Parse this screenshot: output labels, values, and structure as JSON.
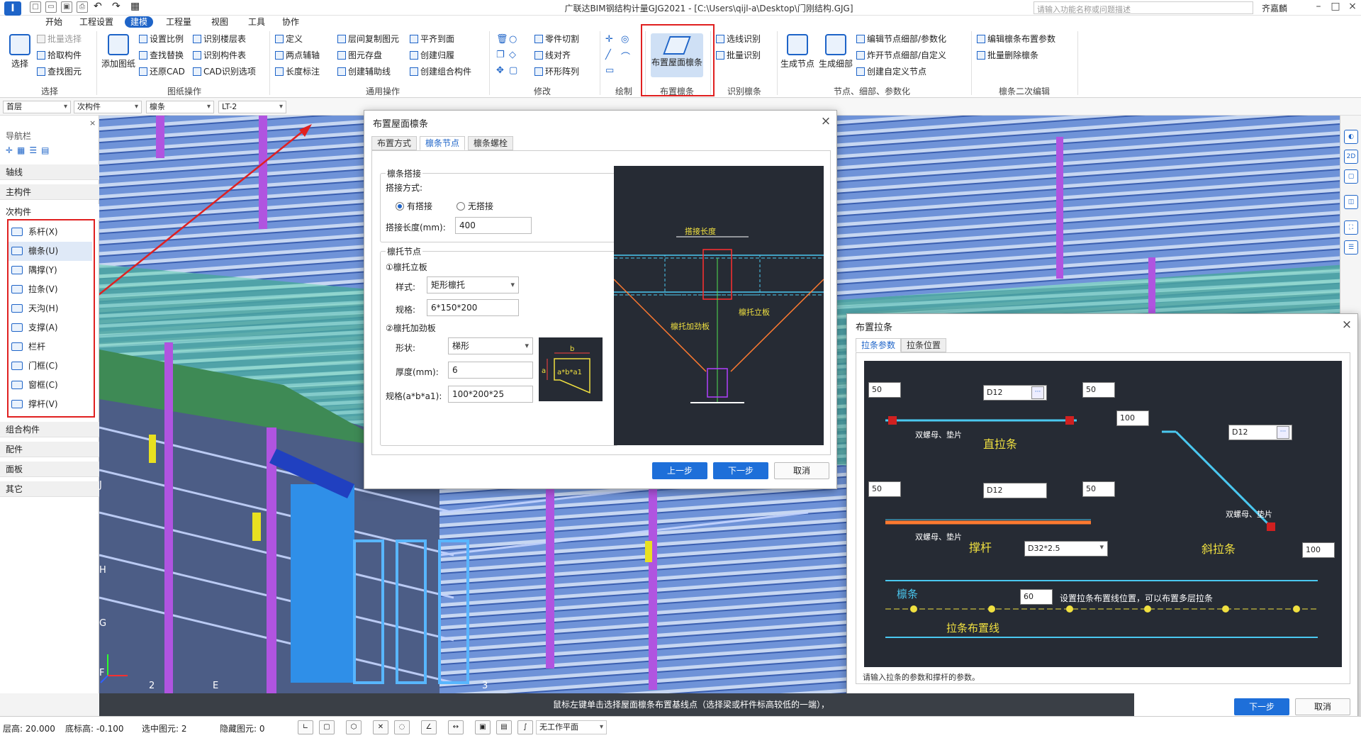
{
  "titlebar": {
    "title": "广联达BIM钢结构计量GJG2021 - [C:\\Users\\qijl-a\\Desktop\\门刚结构.GJG]",
    "search_placeholder": "请输入功能名称或问题描述",
    "user": "齐嘉麟"
  },
  "menu": {
    "tabs": [
      "开始",
      "工程设置",
      "建模",
      "工程量",
      "视图",
      "工具",
      "协作"
    ],
    "active": "建模"
  },
  "ribbon": {
    "select_group": {
      "label": "选择",
      "big": "选择",
      "items": [
        "批量选择",
        "拾取构件",
        "查找图元"
      ]
    },
    "drawing_group": {
      "label": "图纸操作",
      "big": "添加图纸",
      "items": [
        "设置比例",
        "查找替换",
        "还原CAD",
        "识别楼层表",
        "识别构件表",
        "CAD识别选项"
      ]
    },
    "common_group": {
      "label": "通用操作",
      "items": [
        "定义",
        "两点辅轴",
        "长度标注",
        "层间复制图元",
        "图元存盘",
        "创建辅助线",
        "平齐到面",
        "创建归履",
        "创建组合构件"
      ]
    },
    "modify_group": {
      "label": "修改",
      "items": [
        "零件切割",
        "线对齐",
        "环形阵列"
      ]
    },
    "draw_group": {
      "label": "绘制"
    },
    "purlin_group": {
      "label": "布置檩条",
      "big": "布置屋面檩条"
    },
    "identify_group": {
      "label": "识别檩条",
      "items": [
        "选线识别",
        "批量识别"
      ]
    },
    "node_group": {
      "label": "节点、细部、参数化",
      "big1": "生成节点",
      "big2": "生成细部",
      "items": [
        "编辑节点细部/参数化",
        "炸开节点细部/自定义",
        "创建自定义节点"
      ]
    },
    "edit_group": {
      "label": "檩条二次编辑",
      "items": [
        "编辑檩条布置参数",
        "批量删除檩条"
      ]
    }
  },
  "combos": [
    "首层",
    "次构件",
    "檩条",
    "LT-2"
  ],
  "nav": {
    "title": "导航栏",
    "groups_top": [
      "轴线",
      "主构件",
      "次构件"
    ],
    "items": [
      "系杆(X)",
      "檩条(U)",
      "隅撑(Y)",
      "拉条(V)",
      "天沟(H)",
      "支撑(A)",
      "栏杆",
      "门框(C)",
      "窗框(C)",
      "撑杆(V)"
    ],
    "selected": "檩条(U)",
    "groups_bottom": [
      "组合构件",
      "配件",
      "面板",
      "其它"
    ]
  },
  "axis_labels": [
    "J",
    "H",
    "G",
    "F",
    "2",
    "E",
    "3"
  ],
  "dialog1": {
    "title": "布置屋面檩条",
    "tabs": [
      "布置方式",
      "檩条节点",
      "檩条螺栓"
    ],
    "active_tab": "檩条节点",
    "lap": {
      "legend": "檩条搭接",
      "mode_label": "搭接方式:",
      "opt1": "有搭接",
      "opt2": "无搭接",
      "length_label": "搭接长度(mm):",
      "length": "400"
    },
    "bracket": {
      "legend": "檩托节点",
      "sub1": "①檩托立板",
      "style_label": "样式:",
      "style": "矩形檩托",
      "spec_label": "规格:",
      "spec": "6*150*200",
      "sub2": "②檩托加劲板",
      "shape_label": "形状:",
      "shape": "梯形",
      "thick_label": "厚度(mm):",
      "thick": "6",
      "spec2_label": "规格(a*b*a1):",
      "spec2": "100*200*25"
    },
    "mini_labels": {
      "b": "b",
      "a": "a",
      "formula": "a*b*a1"
    },
    "cad": {
      "lap_len": "搭接长度",
      "plate": "檩托立板",
      "stiff": "檩托加劲板"
    },
    "buttons": {
      "prev": "上一步",
      "next": "下一步",
      "cancel": "取消"
    }
  },
  "dialog2": {
    "title": "布置拉条",
    "tabs": [
      "拉条参数",
      "拉条位置"
    ],
    "active_tab": "拉条参数",
    "cad": {
      "v50a": "50",
      "v50b": "50",
      "d12a": "D12",
      "straight": "直拉条",
      "nut1": "双螺母、垫片",
      "v100a": "100",
      "d12c": "D12",
      "oblique": "斜拉条",
      "nut3": "双螺母、垫片",
      "v100b": "100",
      "v50c": "50",
      "v50d": "50",
      "d12b": "D12",
      "strut": "撑杆",
      "nut2": "双螺母、垫片",
      "pipe": "D32*2.5",
      "purlin": "檩条",
      "v60": "60",
      "hint": "设置拉条布置线位置，可以布置多层拉条",
      "line": "拉条布置线"
    },
    "note": "请输入拉条的参数和撑杆的参数。",
    "buttons": {
      "next": "下一步",
      "cancel": "取消"
    }
  },
  "hint": "鼠标左键单击选择屋面檩条布置基线点（选择梁或杆件标高较低的一端），",
  "status": {
    "layer_h": "层高: 20.000",
    "bottom": "底标高: -0.100",
    "selected": "选中图元: 2",
    "hidden": "隐藏图元: 0",
    "plane": "无工作平面"
  },
  "colors": {
    "accent": "#1e64c8",
    "highlight": "#e02020",
    "cad_bg": "#262b34"
  }
}
